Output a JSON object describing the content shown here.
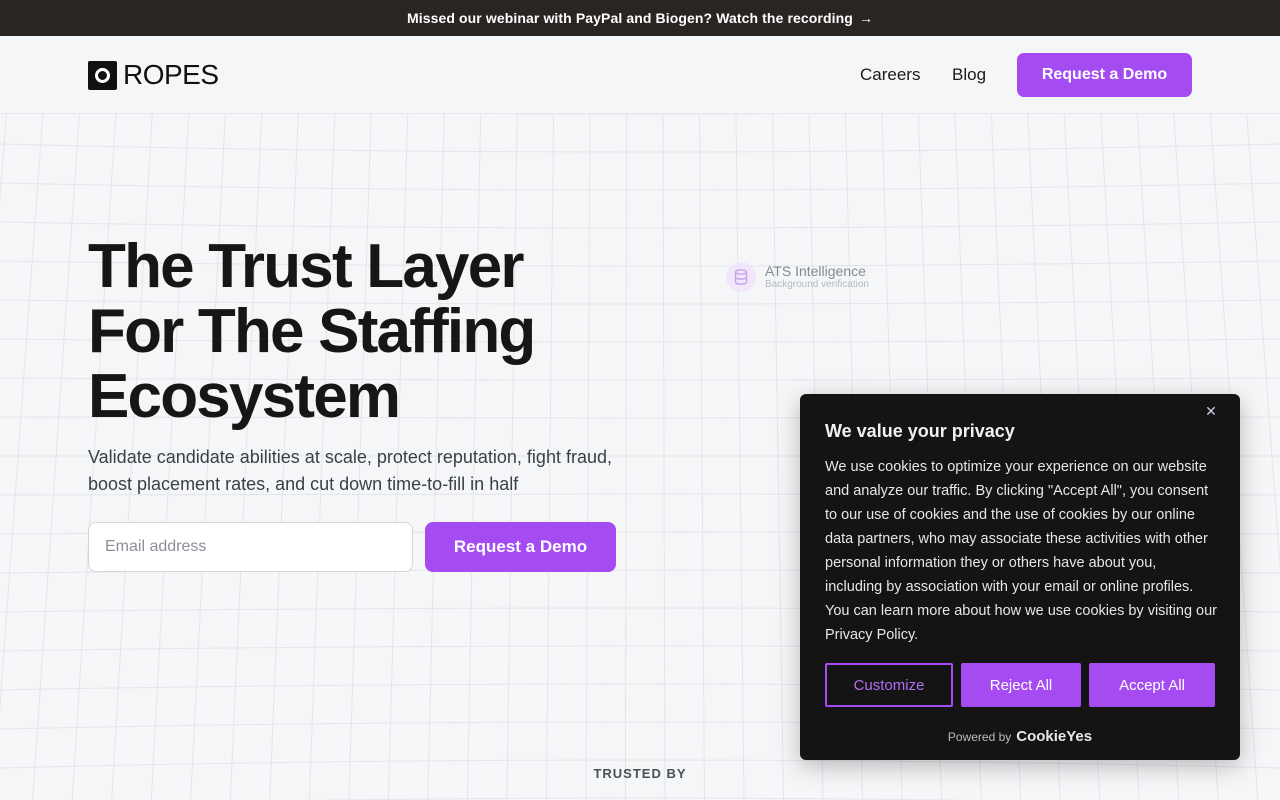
{
  "announcement": {
    "text": "Missed our webinar with PayPal and Biogen? Watch the recording",
    "arrow": "→"
  },
  "header": {
    "logo_text": "ROPES",
    "nav": {
      "careers": "Careers",
      "blog": "Blog"
    },
    "cta_label": "Request a Demo"
  },
  "hero": {
    "title_lines": [
      "The Trust Layer",
      "For The Staffing",
      "Ecosystem"
    ],
    "subtitle": "Validate candidate abilities at scale, protect reputation, fight fraud, boost placement rates, and cut down time-to-fill in half",
    "email_placeholder": "Email address",
    "cta_label": "Request a Demo"
  },
  "ats_chip": {
    "icon": "database-icon",
    "title": "ATS Intelligence",
    "subtitle": "Background verification"
  },
  "trusted_by": "TRUSTED BY",
  "cookie_banner": {
    "title": "We value your privacy",
    "body": "We use cookies to optimize your experience on our website and analyze our traffic. By clicking \"Accept All\", you consent to our use of cookies and the use of cookies by our online data partners, who may associate these activities with other personal information they or others have about you, including by association with your email or online profiles. You can learn more about how we use cookies by visiting our Privacy Policy.",
    "buttons": {
      "customize": "Customize",
      "reject": "Reject All",
      "accept": "Accept All"
    },
    "powered_by": "Powered by",
    "powered_brand": "CookieYes",
    "close_icon": "close-icon"
  },
  "colors": {
    "accent": "#a44cf2",
    "announcement_bg": "#2a2523",
    "page_bg": "#f5f6f8",
    "modal_bg": "#141414"
  }
}
